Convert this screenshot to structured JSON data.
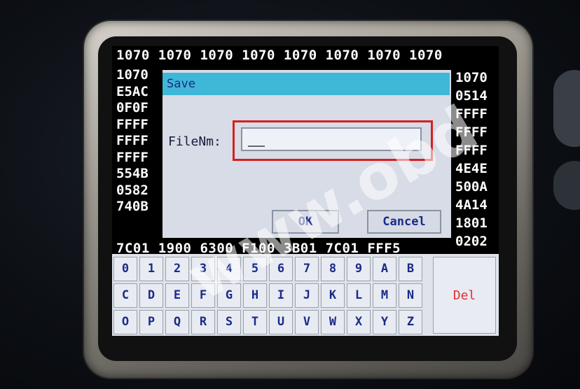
{
  "hex_top": [
    "1070",
    "1070",
    "1070",
    "1070",
    "1070",
    "1070",
    "1070",
    "1070"
  ],
  "hex_left": [
    "1070",
    "E5AC",
    "0F0F",
    "FFFF",
    "FFFF",
    "FFFF",
    "554B",
    "0582",
    "740B"
  ],
  "hex_right": [
    "1070",
    "0514",
    "FFFF",
    "FFFF",
    "FFFF",
    "4E4E",
    "500A",
    "4A14",
    "1801",
    "0202"
  ],
  "hex_bottom": [
    "7C01",
    "1900",
    "6300",
    "F100",
    "3B01",
    "7C01",
    "FFF5"
  ],
  "dialog": {
    "title": "Save",
    "field_label": "FileNm:",
    "field_value": "",
    "ok_label": "OK",
    "cancel_label": "Cancel"
  },
  "keyboard": {
    "row1": [
      "0",
      "1",
      "2",
      "3",
      "4",
      "5",
      "6",
      "7",
      "8",
      "9",
      "A",
      "B"
    ],
    "row2": [
      "C",
      "D",
      "E",
      "F",
      "G",
      "H",
      "I",
      "J",
      "K",
      "L",
      "M",
      "N"
    ],
    "row3": [
      "O",
      "P",
      "Q",
      "R",
      "S",
      "T",
      "U",
      "V",
      "W",
      "X",
      "Y",
      "Z"
    ],
    "del_label": "Del"
  },
  "watermark": "www.obd",
  "colors": {
    "title_bar": "#3fb7d6",
    "highlight": "#d42020",
    "del_text": "#e03030"
  }
}
